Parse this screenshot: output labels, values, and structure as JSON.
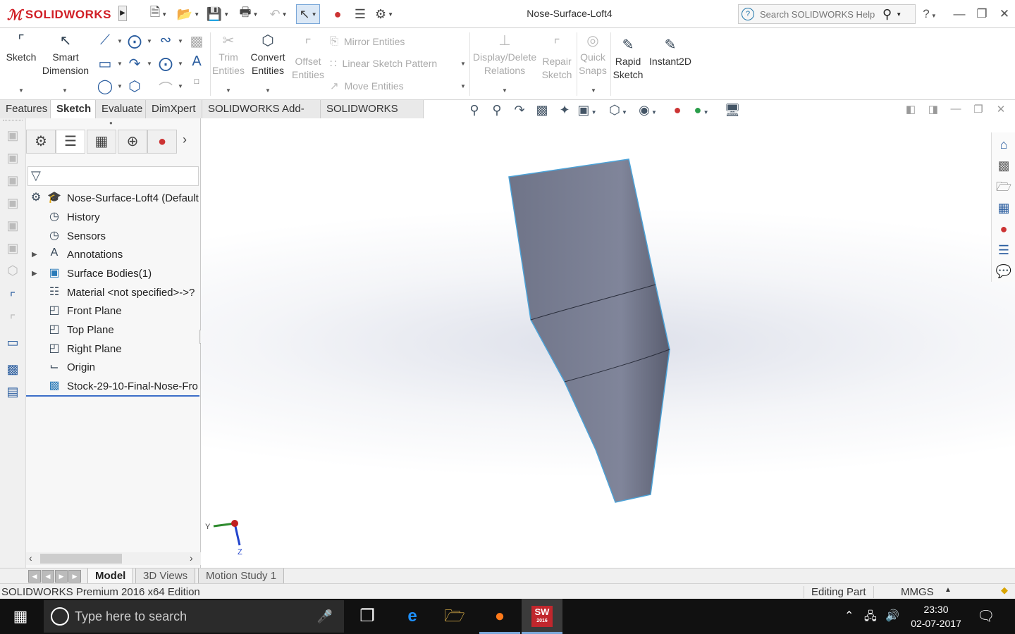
{
  "app": {
    "logo_text": "SOLIDWORKS",
    "document_title": "Nose-Surface-Loft4",
    "help_search_placeholder": "Search SOLIDWORKS Help",
    "help_label": "?"
  },
  "ribbon": {
    "sketch": "Sketch",
    "smart_dimension_1": "Smart",
    "smart_dimension_2": "Dimension",
    "trim_1": "Trim",
    "trim_2": "Entities",
    "convert_1": "Convert",
    "convert_2": "Entities",
    "offset_1": "Offset",
    "offset_2": "Entities",
    "mirror": "Mirror Entities",
    "linear_pattern": "Linear Sketch Pattern",
    "move": "Move Entities",
    "display_delete_1": "Display/Delete",
    "display_delete_2": "Relations",
    "repair_1": "Repair",
    "repair_2": "Sketch",
    "quick_snaps_1": "Quick",
    "quick_snaps_2": "Snaps",
    "rapid_1": "Rapid",
    "rapid_2": "Sketch",
    "instant2d": "Instant2D"
  },
  "command_tabs": [
    "Features",
    "Sketch",
    "Evaluate",
    "DimXpert",
    "SOLIDWORKS Add-Ins",
    "SOLIDWORKS MBD"
  ],
  "feature_tree": {
    "root": "Nose-Surface-Loft4  (Default",
    "items": [
      "History",
      "Sensors",
      "Annotations",
      "Surface Bodies(1)",
      "Material <not specified>->?",
      "Front Plane",
      "Top Plane",
      "Right Plane",
      "Origin",
      "Stock-29-10-Final-Nose-Fro"
    ]
  },
  "triad": {
    "y": "Y",
    "z": "Z"
  },
  "bottom_tabs": [
    "Model",
    "3D Views",
    "Motion Study 1"
  ],
  "status": {
    "left": "SOLIDWORKS Premium 2016 x64 Edition",
    "editing": "Editing Part",
    "units": "MMGS"
  },
  "taskbar": {
    "search_placeholder": "Type here to search",
    "time": "23:30",
    "date": "02-07-2017",
    "sw_badge": "SW",
    "sw_year": "2016"
  },
  "colors": {
    "brand_red": "#d11f26",
    "model_fill": "#7a7f92",
    "model_edge": "#4da3d8",
    "accent_blue": "#2a5d9f"
  }
}
